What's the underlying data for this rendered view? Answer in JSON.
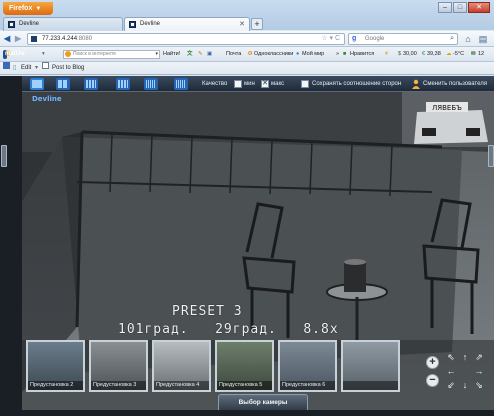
{
  "browser": {
    "menu_button": "Firefox",
    "tabs": [
      {
        "title": "Devline"
      },
      {
        "title": "Devline"
      }
    ],
    "new_tab": "+",
    "url_host": "77.233.4.244",
    "url_port": ":8080",
    "search_engine": "Google",
    "search_placeholder": "Google"
  },
  "toolbar": {
    "brand": "mail.ru",
    "search_placeholder": "Поиск в интернете",
    "find": "Найти!",
    "mail": "Почта",
    "odnoklassniki": "Одноклассники",
    "moymir": "Мой мир",
    "like": "Нравится",
    "usd": "30,00",
    "eur": "39,38",
    "weather": "-5°C",
    "count": "12"
  },
  "bookmarks": {
    "edit": "Edit",
    "post": "Post to Blog"
  },
  "app": {
    "quality_label": "Качество",
    "min_label": "мин",
    "max_label": "макс",
    "max_checked": "✕",
    "aspect_label": "Сохранять соотношение сторон",
    "change_user": "Сменить пользователя",
    "camera_name": "Devline",
    "osd_preset": "PRESET 3",
    "osd_angles": "101град.   29град.   8.8x",
    "presets": [
      "Предустановка 2",
      "Предустановка 3",
      "Предустановка 4",
      "Предустановка 5",
      "Предустановка 6",
      ""
    ],
    "camera_select": "Выбор камеры"
  }
}
